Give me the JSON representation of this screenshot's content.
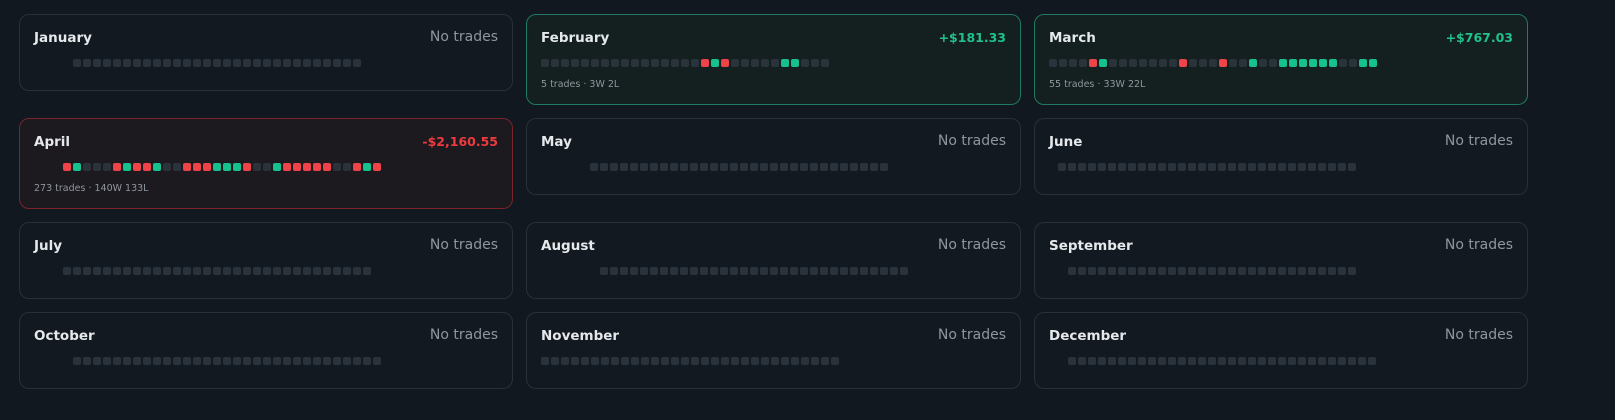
{
  "months": [
    {
      "name": "January",
      "pnl": "No trades",
      "status": "none",
      "summary": "",
      "days": "-----------------------------"
    },
    {
      "name": "February",
      "pnl": "+$181.33",
      "status": "pos",
      "summary": "5 trades · 3W 2L",
      "days": "----------------lwl-----ww---"
    },
    {
      "name": "March",
      "pnl": "+$767.03",
      "status": "pos",
      "summary": "55 trades · 33W 22L",
      "days": "----lw-------l---l--w--wwwwww--ww"
    },
    {
      "name": "April",
      "pnl": "-$2,160.55",
      "status": "neg",
      "summary": "273 trades · 140W 133L",
      "days": "lw---lwllw--lllwwwl--wlllll--lwl"
    },
    {
      "name": "May",
      "pnl": "No trades",
      "status": "none",
      "summary": "",
      "days": "------------------------------"
    },
    {
      "name": "June",
      "pnl": "No trades",
      "status": "none",
      "summary": "",
      "days": "------------------------------"
    },
    {
      "name": "July",
      "pnl": "No trades",
      "status": "none",
      "summary": "",
      "days": "-------------------------------"
    },
    {
      "name": "August",
      "pnl": "No trades",
      "status": "none",
      "summary": "",
      "days": "-------------------------------"
    },
    {
      "name": "September",
      "pnl": "No trades",
      "status": "none",
      "summary": "",
      "days": "-----------------------------"
    },
    {
      "name": "October",
      "pnl": "No trades",
      "status": "none",
      "summary": "",
      "days": "-------------------------------"
    },
    {
      "name": "November",
      "pnl": "No trades",
      "status": "none",
      "summary": "",
      "days": "------------------------------"
    },
    {
      "name": "December",
      "pnl": "No trades",
      "status": "none",
      "summary": "",
      "days": "-------------------------------"
    }
  ],
  "colors": {
    "background": "#111820",
    "win": "#16c18e",
    "loss": "#ee4349",
    "empty": "#2a323b",
    "positive_text": "#22c08a",
    "negative_text": "#ef3b40"
  }
}
